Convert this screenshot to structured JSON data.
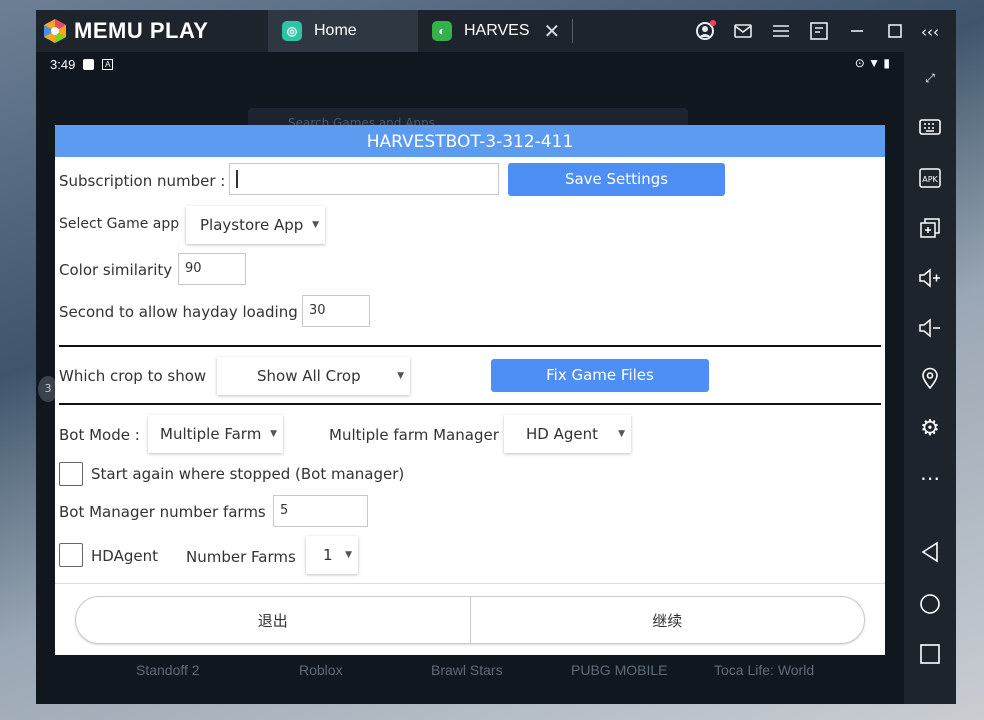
{
  "emulator": {
    "brand": "MEMU PLAY",
    "tabs": [
      {
        "label": "Home",
        "icon": "memu-app-icon"
      },
      {
        "label": "HARVES",
        "icon": "harvestbot-app-icon"
      }
    ],
    "sidebar_collapse": "‹‹‹",
    "colors": {
      "titlebar": "#1d242c",
      "active_tab": "#2f3842",
      "accent": "#5b9cf0"
    }
  },
  "statusbar": {
    "time": "3:49"
  },
  "background": {
    "search_placeholder": "Search Games and Apps",
    "apps": [
      "Standoff 2",
      "Roblox",
      "Brawl Stars",
      "PUBG MOBILE",
      "Toca Life: World"
    ],
    "side_number": "3"
  },
  "dialog": {
    "title": "HARVESTBOT-3-312-411",
    "subscription_label": "Subscription number :",
    "subscription_value": "",
    "save_settings": "Save Settings",
    "select_game_label": "Select Game app",
    "game_app": "Playstore App",
    "color_similarity_label": "Color similarity",
    "color_similarity": "90",
    "loading_label": "Second to allow hayday loading",
    "loading_seconds": "30",
    "crop_label": "Which crop to show",
    "crop_value": "Show All Crop",
    "fix_game_files": "Fix Game Files",
    "bot_mode_label": "Bot Mode :",
    "bot_mode": "Multiple Farm",
    "manager_label": "Multiple farm Manager",
    "manager_value": "HD Agent",
    "start_again_label": "Start again where stopped (Bot manager)",
    "start_again_checked": false,
    "farms_label": "Bot Manager number farms",
    "farms_value": "5",
    "hdagent_label": "HDAgent",
    "hdagent_checked": false,
    "number_farms_label": "Number Farms",
    "number_farms": "1",
    "exit": "退出",
    "continue": "继续"
  }
}
